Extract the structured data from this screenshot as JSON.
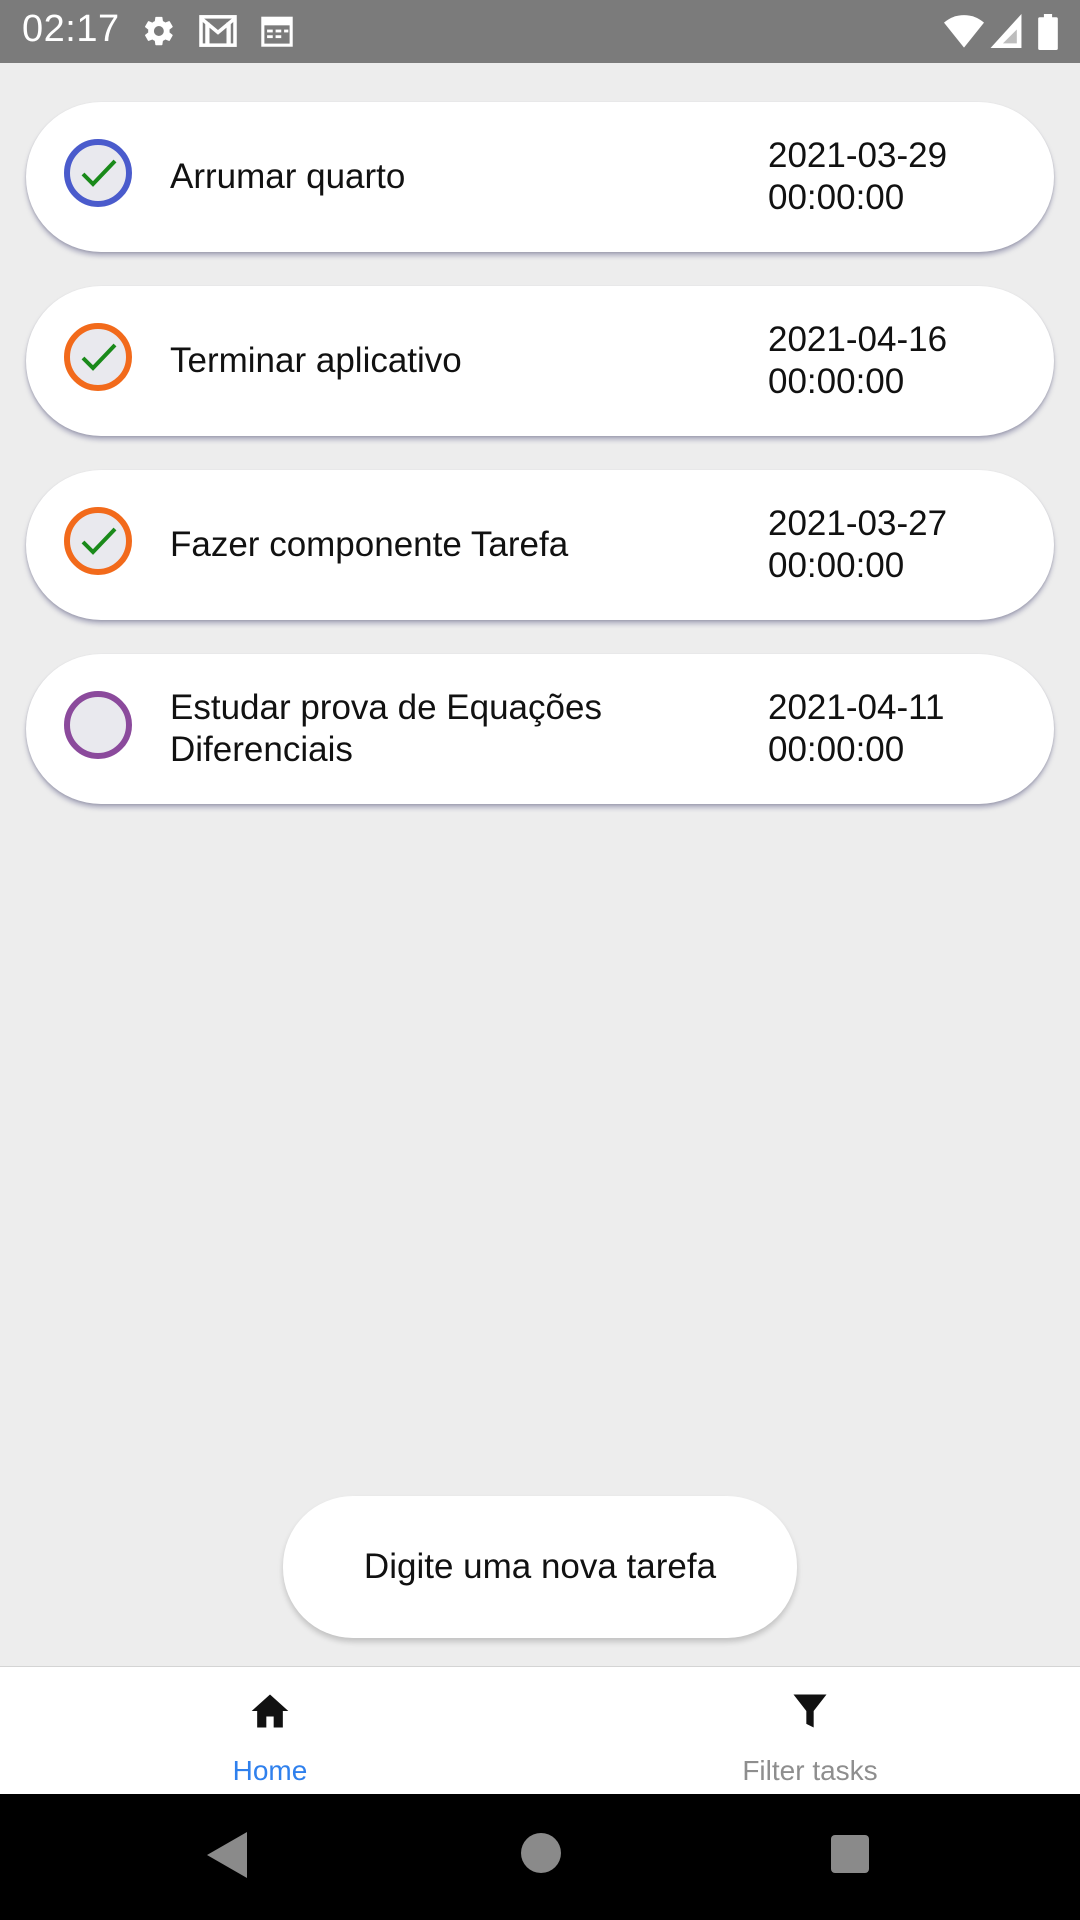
{
  "status_bar": {
    "time": "02:17",
    "left_icons": [
      "gear-icon",
      "gmail-icon",
      "calendar-icon"
    ],
    "right_icons": [
      "wifi-icon",
      "signal-icon",
      "battery-icon"
    ]
  },
  "tasks": [
    {
      "title": "Arrumar quarto",
      "date": "2021-03-29",
      "time": "00:00:00",
      "done": true,
      "ring_color": "#4a5bcc"
    },
    {
      "title": "Terminar aplicativo",
      "date": "2021-04-16",
      "time": "00:00:00",
      "done": true,
      "ring_color": "#f26a1b"
    },
    {
      "title": "Fazer componente Tarefa",
      "date": "2021-03-27",
      "time": "00:00:00",
      "done": true,
      "ring_color": "#f26a1b"
    },
    {
      "title": "Estudar prova de Equações Diferenciais",
      "date": "2021-04-11",
      "time": "00:00:00",
      "done": false,
      "ring_color": "#8b4a9c"
    }
  ],
  "new_task": {
    "placeholder": "Digite uma nova tarefa",
    "value": ""
  },
  "tabs": [
    {
      "label": "Home",
      "icon": "home-icon",
      "active": true,
      "color": "#2f80ed"
    },
    {
      "label": "Filter tasks",
      "icon": "filter-icon",
      "active": false,
      "color": "#8e8e8e"
    }
  ],
  "colors": {
    "check": "#1a8a1a",
    "status_bar": "#7b7b7b",
    "background": "#ededed"
  }
}
